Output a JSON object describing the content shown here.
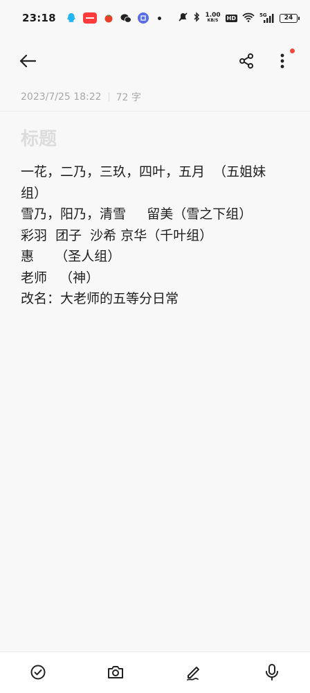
{
  "status_bar": {
    "time": "23:18",
    "net_speed": "1.00",
    "net_unit": "KB/S",
    "hd": "HD",
    "signal_gen": "5G",
    "battery": "24"
  },
  "toolbar": {
    "back_icon": "arrow-left-icon",
    "share_icon": "share-icon",
    "more_icon": "more-vertical-icon",
    "badge_color": "#f04a3e"
  },
  "note": {
    "date": "2023/7/25 18:22",
    "char_count": "72 字",
    "title_placeholder": "标题",
    "lines": [
      "一花，二乃，三玖，四叶，五月  （五姐妹",
      "组）",
      "雪乃，阳乃，清雪     留美（雪之下组）",
      "彩羽  团子  沙希 京华（千叶组）",
      "惠     （圣人组）",
      "老师   （神）",
      "改名：大老师的五等分日常"
    ]
  },
  "bottom_bar": {
    "items": [
      "checklist-icon",
      "camera-icon",
      "pen-icon",
      "microphone-icon"
    ]
  }
}
